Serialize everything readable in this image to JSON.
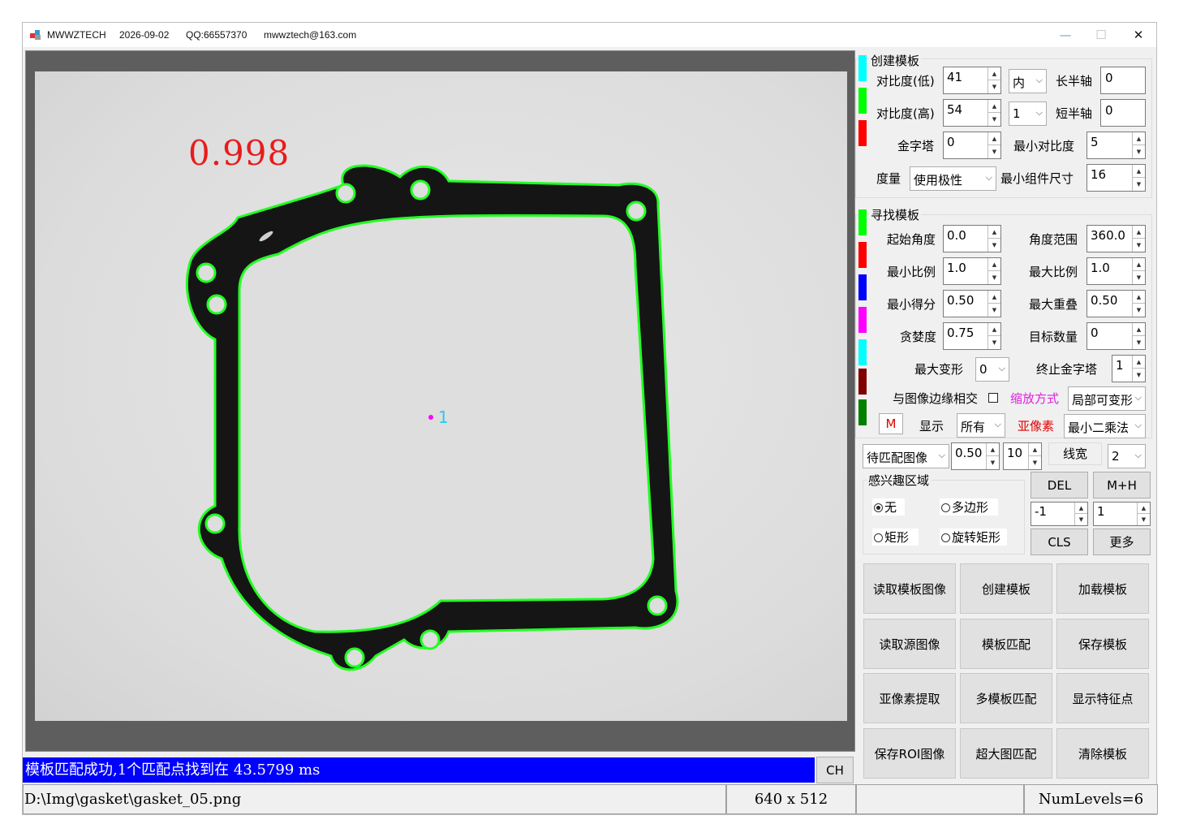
{
  "window": {
    "app_name": "MWWZTECH",
    "date": "2026-09-02",
    "qq": "QQ:66557370",
    "email": "mwwztech@163.com",
    "minimize_symbol": "—",
    "maximize_symbol": "☐",
    "close_symbol": "✕"
  },
  "viewer": {
    "score_text": "0.998",
    "match_label": "1",
    "status_text": "模板匹配成功,1个匹配点找到在 43.5799 ms",
    "ch_button": "CH"
  },
  "footer": {
    "file_path": "D:\\Img\\gasket\\gasket_05.png",
    "image_size": "640 x 512",
    "num_levels": "NumLevels=6"
  },
  "create_template": {
    "title": "创建模板",
    "contrast_low_label": "对比度(低)",
    "contrast_low_value": "41",
    "contrast_high_label": "对比度(高)",
    "contrast_high_value": "54",
    "pyramid_label": "金字塔",
    "pyramid_value": "0",
    "metric_label": "度量",
    "metric_value": "使用极性",
    "inner_value": "内",
    "num_value": "1",
    "major_axis_label": "长半轴",
    "major_axis_value": "0",
    "minor_axis_label": "短半轴",
    "minor_axis_value": "0",
    "min_contrast_label": "最小对比度",
    "min_contrast_value": "5",
    "min_component_label": "最小组件尺寸",
    "min_component_value": "16",
    "swatch_colors": [
      "#00ffff",
      "#00ff00",
      "#ff0000"
    ]
  },
  "find_template": {
    "title": "寻找模板",
    "start_angle_label": "起始角度",
    "start_angle_value": "0.0",
    "angle_range_label": "角度范围",
    "angle_range_value": "360.0",
    "min_scale_label": "最小比例",
    "min_scale_value": "1.0",
    "max_scale_label": "最大比例",
    "max_scale_value": "1.0",
    "min_score_label": "最小得分",
    "min_score_value": "0.50",
    "max_overlap_label": "最大重叠",
    "max_overlap_value": "0.50",
    "greediness_label": "贪婪度",
    "greediness_value": "0.75",
    "num_targets_label": "目标数量",
    "num_targets_value": "0",
    "max_deform_label": "最大变形",
    "max_deform_value": "0",
    "end_pyramid_label": "终止金字塔",
    "end_pyramid_value": "1",
    "border_intersect_label": "与图像边缘相交",
    "scale_mode_label": "缩放方式",
    "scale_mode_value": "局部可变形",
    "m_button": "M",
    "display_label": "显示",
    "display_value": "所有",
    "subpixel_label": "亚像素",
    "subpixel_value": "最小二乘法",
    "swatch_colors": [
      "#00ff00",
      "#ff0000",
      "#0000ff",
      "#ff00ff",
      "#00ffff",
      "#800000",
      "#008000"
    ]
  },
  "line_controls": {
    "image_select": "待匹配图像",
    "opacity_value": "0.50",
    "size_value": "10",
    "line_width_label": "线宽",
    "line_width_value": "2"
  },
  "roi": {
    "title": "感兴趣区域",
    "none_label": "无",
    "polygon_label": "多边形",
    "rect_label": "矩形",
    "rotated_rect_label": "旋转矩形"
  },
  "side_buttons": {
    "del": "DEL",
    "mh": "M+H",
    "cls": "CLS",
    "more": "更多",
    "spin1_value": "-1",
    "spin2_value": "1"
  },
  "actions": [
    "读取模板图像",
    "创建模板",
    "加载模板",
    "读取源图像",
    "模板匹配",
    "保存模板",
    "亚像素提取",
    "多模板匹配",
    "显示特征点",
    "保存ROI图像",
    "超大图匹配",
    "清除模板"
  ]
}
